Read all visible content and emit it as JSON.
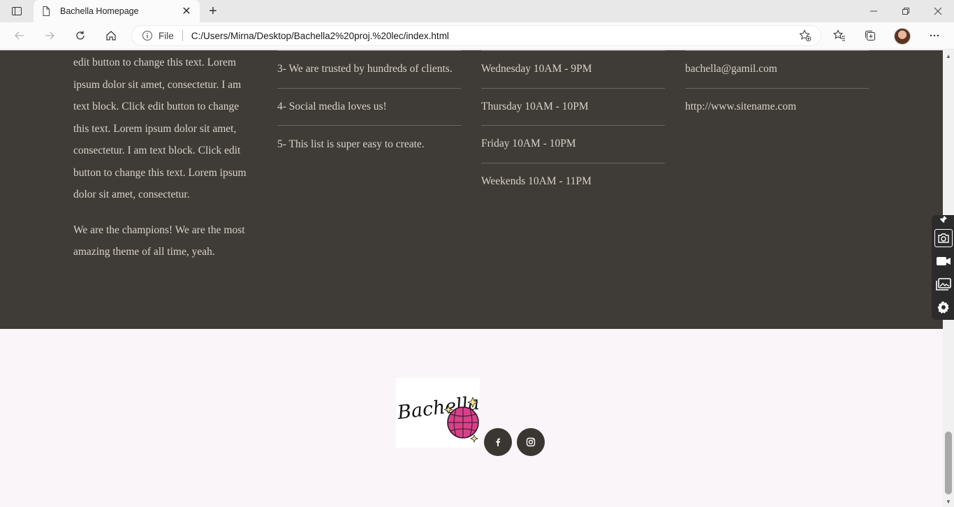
{
  "browser": {
    "tab_title": "Bachella Homepage",
    "address_scheme": "File",
    "url": "C:/Users/Mirna/Desktop/Bachella2%20proj.%20lec/index.html"
  },
  "about": {
    "paragraph1": "edit button to change this text. Lorem ipsum dolor sit amet, consectetur. I am text block. Click edit button to change this text. Lorem ipsum dolor sit amet, consectetur. I am text block. Click edit button to change this text. Lorem ipsum dolor sit amet, consectetur.",
    "paragraph2": "We are the champions! We are the most amazing theme of all time, yeah."
  },
  "reasons": [
    "3- We are trusted by hundreds of clients.",
    "4- Social media loves us!",
    "5- This list is super easy to create."
  ],
  "hours": [
    "Wednesday 10AM - 9PM",
    "Thursday 10AM - 10PM",
    "Friday 10AM - 10PM",
    "Weekends 10AM - 11PM"
  ],
  "contact": {
    "email": "bachella@gamil.com",
    "website": "http://www.sitename.com"
  },
  "footer": {
    "logo_text": "Bachella"
  },
  "colors": {
    "dark_section": "#3f3b36",
    "text_light": "#d9d3ca",
    "footer_bg": "#f9f5f8",
    "social_bg": "#3a3632"
  }
}
